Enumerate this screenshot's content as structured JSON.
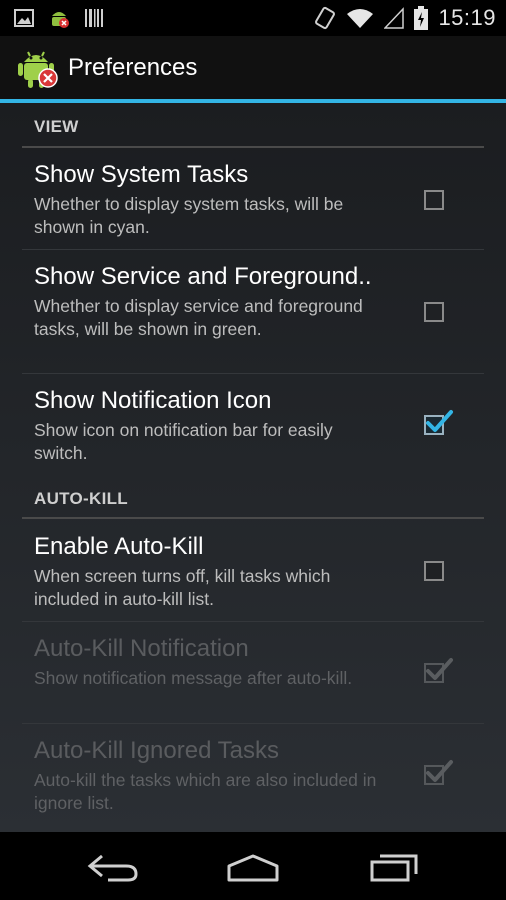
{
  "status_bar": {
    "time": "15:19",
    "left_icons": [
      "image-notification-icon",
      "android-killer-notification-icon",
      "barcode-notification-icon"
    ],
    "right_icons": [
      "phone-vibrate-icon",
      "wifi-icon",
      "signal-icon",
      "battery-charging-icon"
    ]
  },
  "action_bar": {
    "title": "Preferences",
    "icon": "android-app-icon",
    "accent_color": "#33b5e5"
  },
  "categories": [
    {
      "label": "VIEW",
      "items": [
        {
          "title": "Show System Tasks",
          "summary": "Whether to display system tasks, will be shown in cyan.",
          "checked": false,
          "enabled": true
        },
        {
          "title": "Show Service and Foreground..",
          "summary": "Whether to display service and foreground tasks, will be shown in green.",
          "checked": false,
          "enabled": true
        },
        {
          "title": "Show Notification Icon",
          "summary": "Show icon on notification bar for easily switch.",
          "checked": true,
          "enabled": true
        }
      ]
    },
    {
      "label": "AUTO-KILL",
      "items": [
        {
          "title": "Enable Auto-Kill",
          "summary": "When screen turns off, kill tasks which included in auto-kill list.",
          "checked": false,
          "enabled": true
        },
        {
          "title": "Auto-Kill Notification",
          "summary": "Show notification message after auto-kill.",
          "checked": true,
          "enabled": false
        },
        {
          "title": "Auto-Kill Ignored Tasks",
          "summary": "Auto-kill the tasks which are also included in ignore list.",
          "checked": true,
          "enabled": false
        }
      ]
    }
  ],
  "nav_bar": {
    "buttons": [
      "back-icon",
      "home-icon",
      "recent-apps-icon"
    ]
  }
}
